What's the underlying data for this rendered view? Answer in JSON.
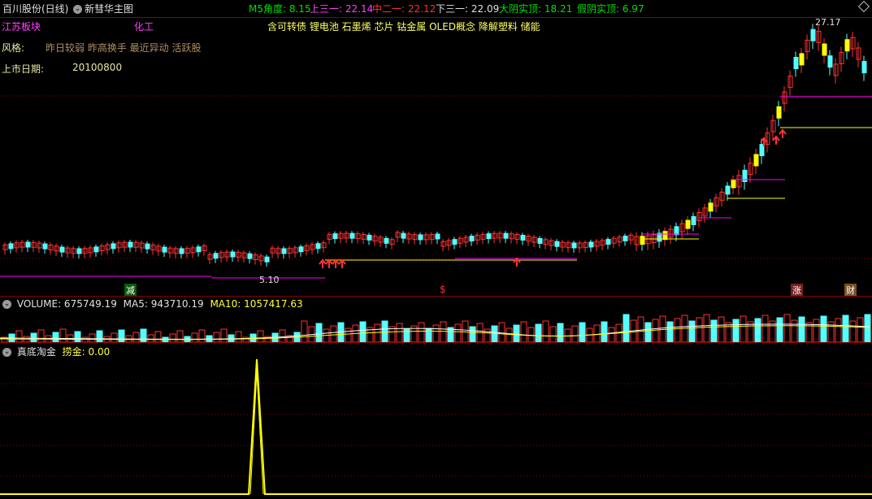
{
  "header": {
    "stock_name": "百川股份(日线)",
    "indicator_name": "新彗华主图",
    "m5_angle": "M5角度: 8.15",
    "upper3": "上三一: 22.14",
    "mid2": "中二一: 22.12",
    "lower3": "下三一: 22.09",
    "big_yin": "大阴实顶: 18.21",
    "fake_yin": "假阴实顶: 6.97"
  },
  "info": {
    "region": "江苏板块",
    "industry": "化工",
    "concepts": "含可转债 锂电池 石墨烯 芯片 钴金属 OLED概念 降解塑料 储能",
    "style_label": "风格:",
    "style_value": "昨日较弱 昨高换手 最近异动 活跃股",
    "listing_label": "上市日期:",
    "listing_value": "20100800"
  },
  "markers": {
    "high_price": "27.17",
    "low_price": "5.10",
    "tag_reduce": "减",
    "tag_dollar": "$",
    "tag_rise": "涨",
    "tag_finance": "财"
  },
  "volume_panel": {
    "title": "VOLUME: 675749.19",
    "ma5": "MA5: 943710.19",
    "ma10": "MA10: 1057417.63"
  },
  "bottom_panel": {
    "title": "真底淘金",
    "value": "捞金: 0.00"
  },
  "colors": {
    "bg": "#000000",
    "up": "#ff3232",
    "down": "#54ffff",
    "yellow": "#ffff00",
    "magenta": "#ff00ff",
    "green": "#00ff00",
    "grid": "#8b0000"
  },
  "chart_data": [
    {
      "type": "candlestick",
      "title": "百川股份(日线)",
      "price_range": [
        5.1,
        27.17
      ],
      "annotations": [
        "27.17",
        "5.10"
      ]
    },
    {
      "type": "bar",
      "title": "VOLUME",
      "series": [
        {
          "name": "VOLUME",
          "last": 675749.19
        },
        {
          "name": "MA5",
          "last": 943710.19
        },
        {
          "name": "MA10",
          "last": 1057417.63
        }
      ]
    },
    {
      "type": "line",
      "title": "真底淘金",
      "series": [
        {
          "name": "捞金",
          "last": 0.0
        }
      ]
    }
  ]
}
